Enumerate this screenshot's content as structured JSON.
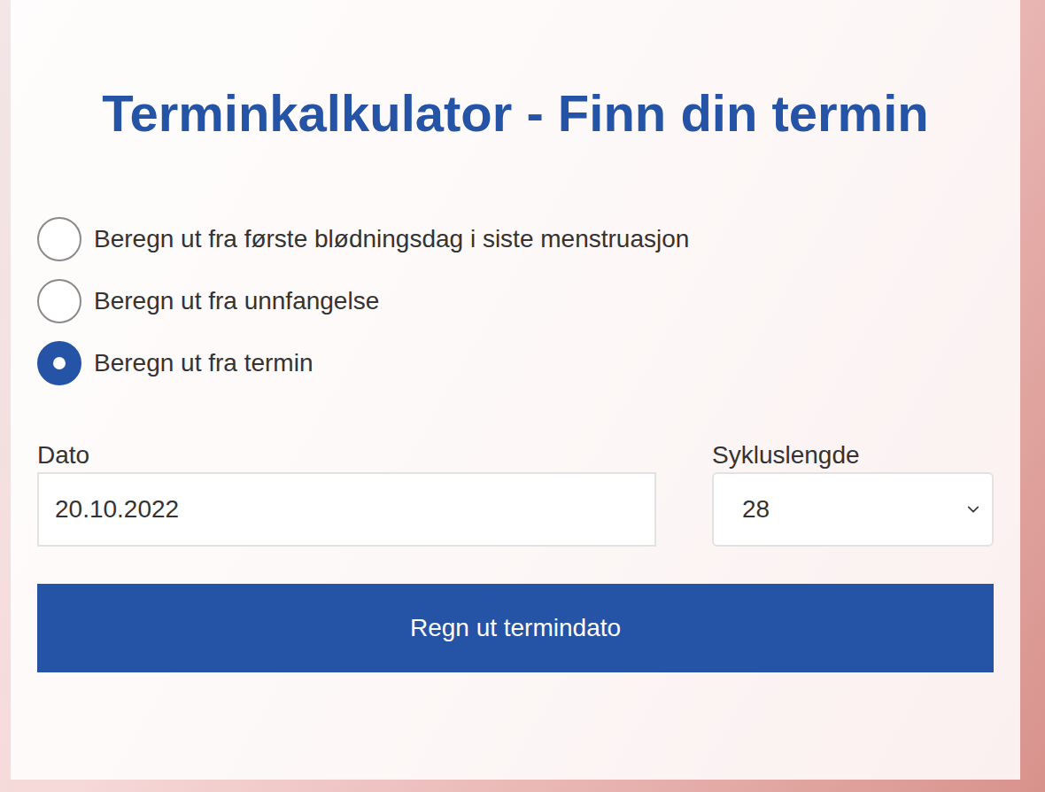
{
  "title": "Terminkalkulator - Finn din termin",
  "options": [
    {
      "label": "Beregn ut fra første blødningsdag i siste menstruasjon",
      "selected": false
    },
    {
      "label": "Beregn ut fra unnfangelse",
      "selected": false
    },
    {
      "label": "Beregn ut fra termin",
      "selected": true
    }
  ],
  "date": {
    "label": "Dato",
    "value": "20.10.2022"
  },
  "cycle": {
    "label": "Sykluslengde",
    "value": "28"
  },
  "button": "Regn ut termindato"
}
